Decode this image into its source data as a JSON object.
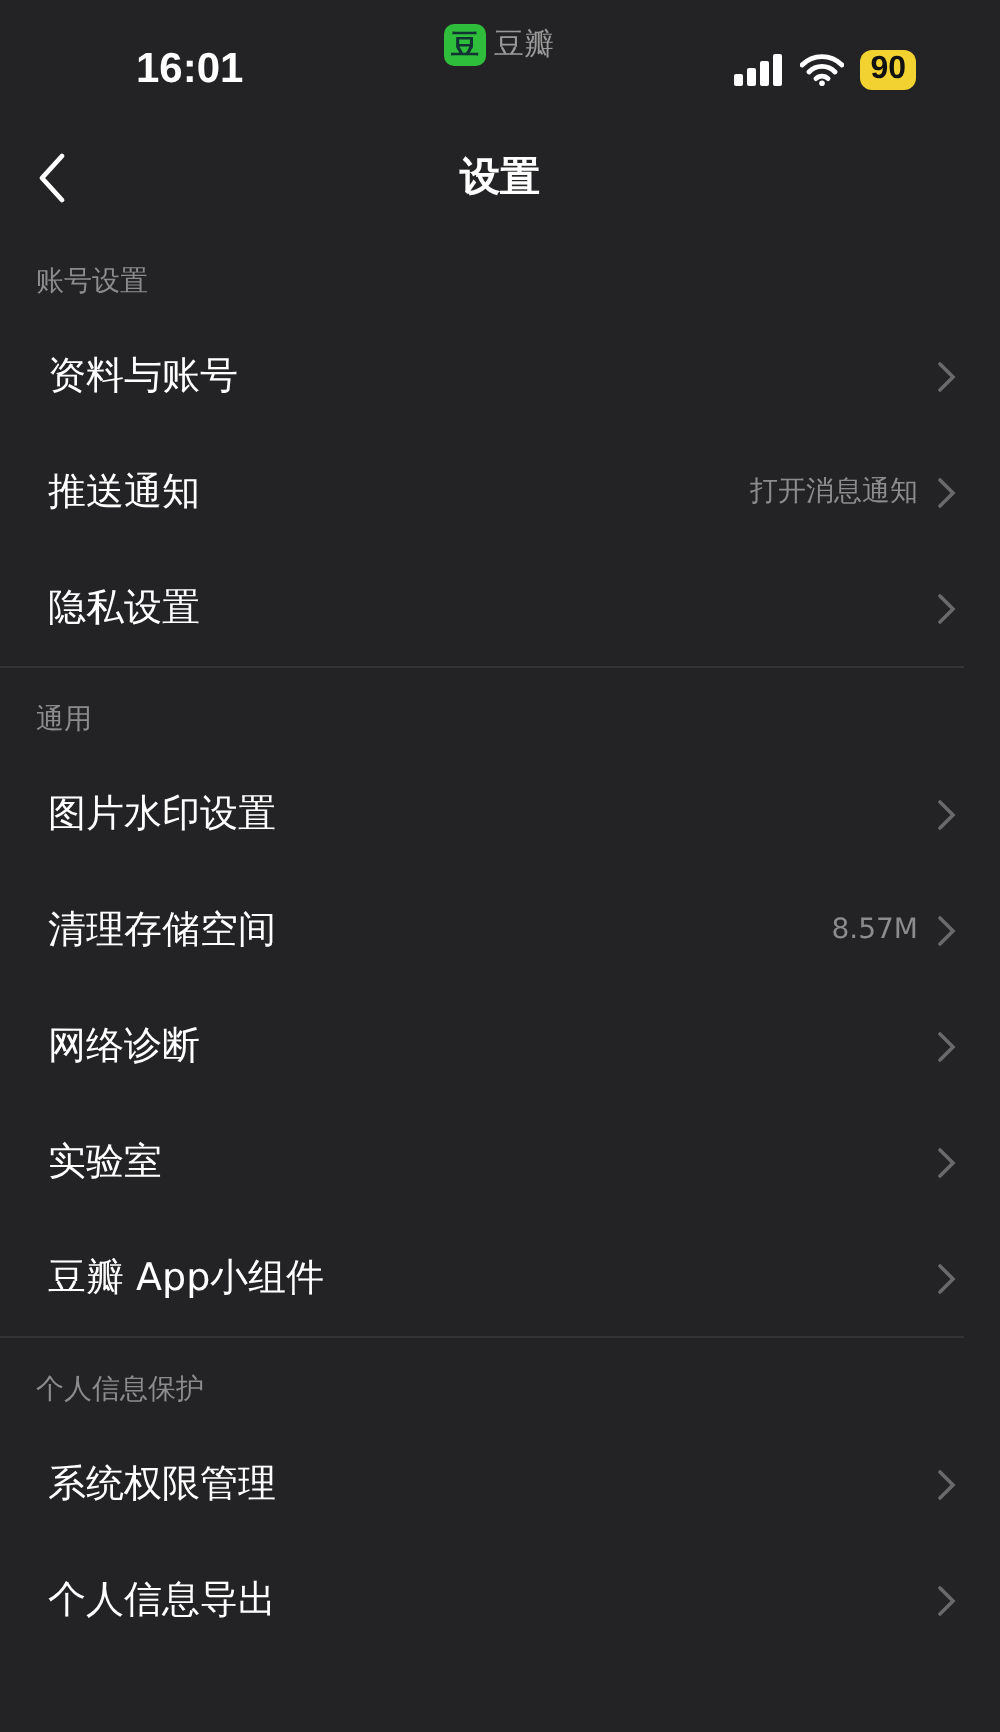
{
  "status_bar": {
    "time": "16:01",
    "app_logo": "豆",
    "app_name": "豆瓣",
    "battery": "90"
  },
  "nav": {
    "title": "设置"
  },
  "sections": [
    {
      "header": "账号设置",
      "rows": [
        {
          "label": "资料与账号"
        },
        {
          "label": "推送通知",
          "value": "打开消息通知"
        },
        {
          "label": "隐私设置"
        }
      ]
    },
    {
      "header": "通用",
      "rows": [
        {
          "label": "图片水印设置"
        },
        {
          "label": "清理存储空间",
          "value": "8.57M"
        },
        {
          "label": "网络诊断"
        },
        {
          "label": "实验室"
        },
        {
          "label": "豆瓣 App小组件"
        }
      ]
    },
    {
      "header": "个人信息保护",
      "rows": [
        {
          "label": "系统权限管理"
        },
        {
          "label": "个人信息导出"
        }
      ]
    }
  ]
}
